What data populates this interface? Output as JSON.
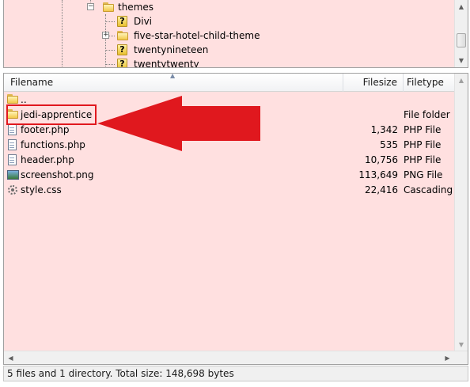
{
  "tree": {
    "nodes": [
      {
        "label": "themes",
        "icon": "folder-icon",
        "expander": "−"
      },
      {
        "label": "Divi",
        "icon": "unknown-icon"
      },
      {
        "label": "five-star-hotel-child-theme",
        "icon": "folder-icon",
        "expander": "+"
      },
      {
        "label": "twentynineteen",
        "icon": "unknown-icon"
      },
      {
        "label": "twentytwenty",
        "icon": "unknown-icon"
      }
    ],
    "unknown_glyph": "?"
  },
  "list": {
    "columns": {
      "filename": "Filename",
      "filesize": "Filesize",
      "filetype": "Filetype"
    },
    "rows": [
      {
        "name": "..",
        "size": "",
        "type": "",
        "icon": "folder-icon"
      },
      {
        "name": "jedi-apprentice",
        "size": "",
        "type": "File folder",
        "icon": "folder-icon"
      },
      {
        "name": "footer.php",
        "size": "1,342",
        "type": "PHP File",
        "icon": "php-file-icon"
      },
      {
        "name": "functions.php",
        "size": "535",
        "type": "PHP File",
        "icon": "php-file-icon"
      },
      {
        "name": "header.php",
        "size": "10,756",
        "type": "PHP File",
        "icon": "php-file-icon"
      },
      {
        "name": "screenshot.png",
        "size": "113,649",
        "type": "PNG File",
        "icon": "image-file-icon"
      },
      {
        "name": "style.css",
        "size": "22,416",
        "type": "Cascading ...",
        "icon": "css-file-icon"
      }
    ]
  },
  "annotation": {
    "highlight_color": "#e0181e",
    "arrow_color": "#e0181e"
  },
  "status": {
    "text": "5 files and 1 directory. Total size: 148,698 bytes"
  },
  "colors": {
    "pane_background": "#ffe0e0"
  }
}
